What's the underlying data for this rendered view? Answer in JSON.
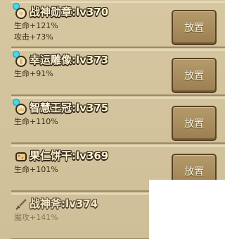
{
  "items": [
    {
      "name": "战神勋章:lv370",
      "stats": [
        "生命+121%",
        "攻击+73%"
      ],
      "button": "放置",
      "icon": "medal-icon",
      "gem": true
    },
    {
      "name": "幸运雕像:lv373",
      "stats": [
        "生命+91%"
      ],
      "button": "放置",
      "icon": "statue-icon",
      "gem": true
    },
    {
      "name": "智慧王冠:lv375",
      "stats": [
        "生命+110%"
      ],
      "button": "放置",
      "icon": "crown-icon",
      "gem": true
    },
    {
      "name": "果仁饼干:lv369",
      "stats": [
        "生命+101%"
      ],
      "button": "放置",
      "icon": "biscuit-icon",
      "gem": false
    },
    {
      "name": "战神斧:lv374",
      "stats": [
        "魔攻+141%"
      ],
      "button": "",
      "icon": "sword-icon",
      "gem": false
    }
  ],
  "colors": {
    "gem": "#48d8e8",
    "button": "#a68a5a"
  }
}
